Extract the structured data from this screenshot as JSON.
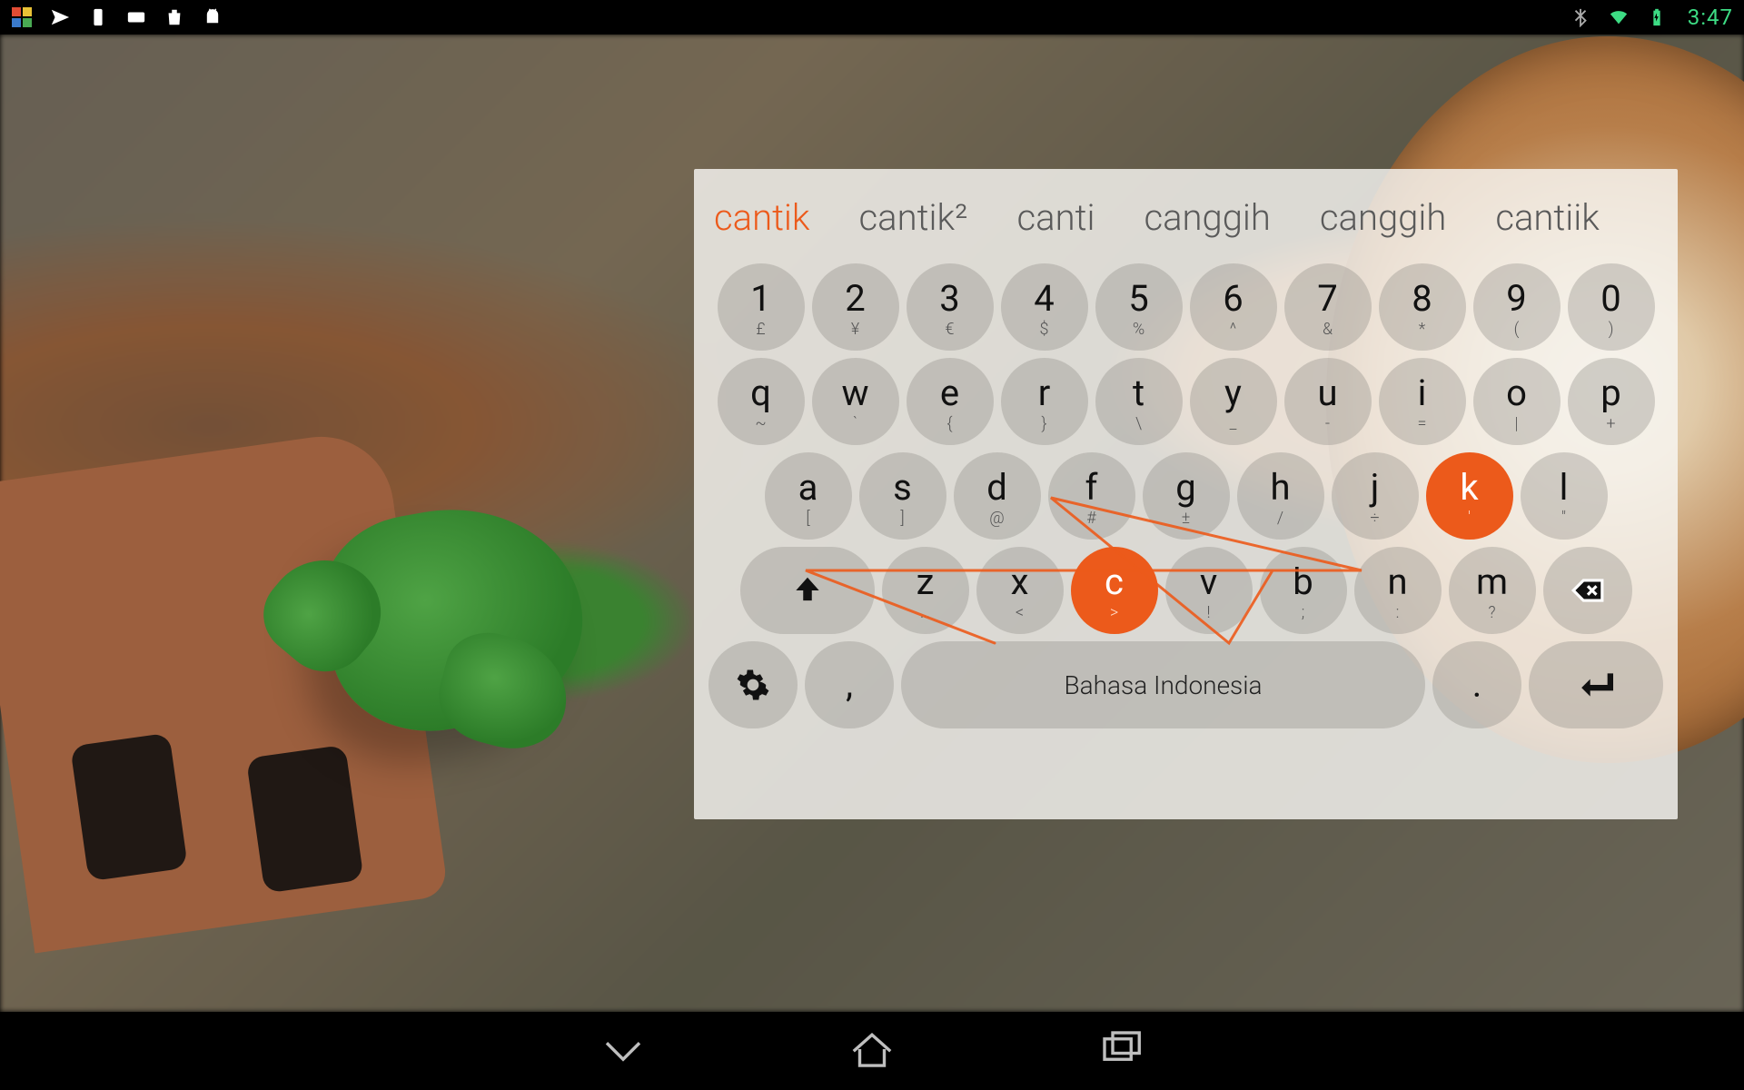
{
  "statusbar": {
    "clock": "3:47"
  },
  "suggestions": {
    "primary": "cantik",
    "rest": [
      "cantik²",
      "canti",
      "canggih",
      "canggih",
      "cantiik"
    ]
  },
  "numberRow": [
    {
      "main": "1",
      "sub": "£"
    },
    {
      "main": "2",
      "sub": "¥"
    },
    {
      "main": "3",
      "sub": "€"
    },
    {
      "main": "4",
      "sub": "$"
    },
    {
      "main": "5",
      "sub": "%"
    },
    {
      "main": "6",
      "sub": "^"
    },
    {
      "main": "7",
      "sub": "&"
    },
    {
      "main": "8",
      "sub": "*"
    },
    {
      "main": "9",
      "sub": "("
    },
    {
      "main": "0",
      "sub": ")"
    }
  ],
  "qwertyRow": [
    {
      "main": "q",
      "sub": "~"
    },
    {
      "main": "w",
      "sub": "`"
    },
    {
      "main": "e",
      "sub": "{"
    },
    {
      "main": "r",
      "sub": "}"
    },
    {
      "main": "t",
      "sub": "\\"
    },
    {
      "main": "y",
      "sub": "_"
    },
    {
      "main": "u",
      "sub": "-"
    },
    {
      "main": "i",
      "sub": "="
    },
    {
      "main": "o",
      "sub": "|"
    },
    {
      "main": "p",
      "sub": "+"
    }
  ],
  "asdfRow": [
    {
      "main": "a",
      "sub": "["
    },
    {
      "main": "s",
      "sub": "]"
    },
    {
      "main": "d",
      "sub": "@"
    },
    {
      "main": "f",
      "sub": "#"
    },
    {
      "main": "g",
      "sub": "±"
    },
    {
      "main": "h",
      "sub": "/"
    },
    {
      "main": "j",
      "sub": "÷"
    },
    {
      "main": "k",
      "sub": "'"
    },
    {
      "main": "l",
      "sub": "\""
    }
  ],
  "zxcvRow": [
    {
      "main": "z",
      "sub": "…"
    },
    {
      "main": "x",
      "sub": "<"
    },
    {
      "main": "c",
      "sub": ">"
    },
    {
      "main": "v",
      "sub": "!"
    },
    {
      "main": "b",
      "sub": ";"
    },
    {
      "main": "n",
      "sub": ":"
    },
    {
      "main": "m",
      "sub": "?"
    }
  ],
  "space": {
    "label": "Bahasa Indonesia"
  },
  "comma": {
    "label": ","
  },
  "period": {
    "label": "."
  },
  "activeKeys": [
    "c",
    "k"
  ],
  "colors": {
    "accent": "#ec5a1b",
    "keyBg": "rgba(140,138,132,0.35)",
    "panelBg": "rgba(248,246,243,0.82)"
  }
}
